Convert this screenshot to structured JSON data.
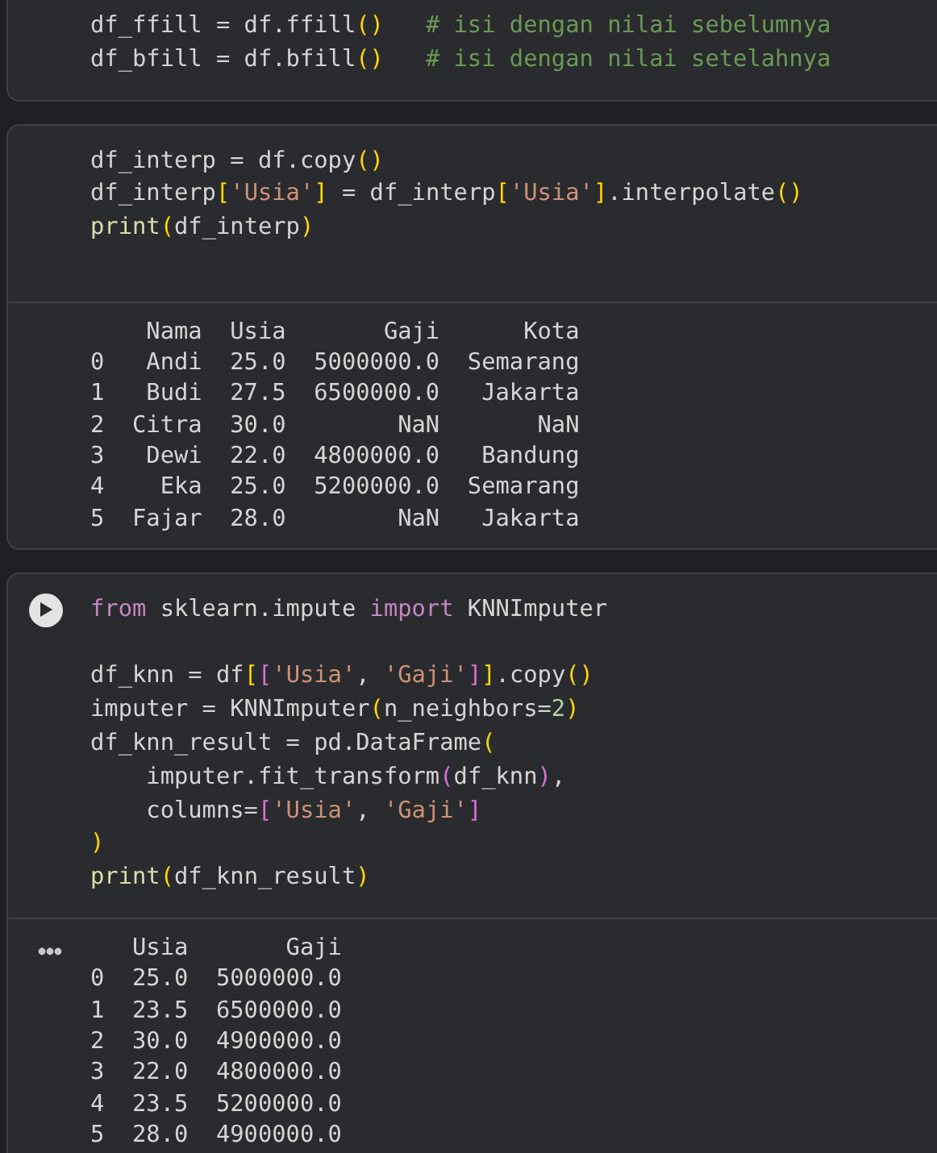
{
  "cells": [
    {
      "run_button": false,
      "code": [
        {
          "tokens": [
            {
              "text": "df_ffill = df.ffill",
              "kind": "plain"
            },
            {
              "text": "()",
              "kind": "paren"
            },
            {
              "text": "   # isi dengan nilai sebelumnya",
              "kind": "comment"
            }
          ]
        },
        {
          "tokens": [
            {
              "text": "df_bfill = df.bfill",
              "kind": "plain"
            },
            {
              "text": "()",
              "kind": "paren"
            },
            {
              "text": "   # isi dengan nilai setelahnya",
              "kind": "comment"
            }
          ]
        }
      ]
    },
    {
      "run_button": false,
      "code": [
        {
          "tokens": [
            {
              "text": "df_interp = df.copy",
              "kind": "plain"
            },
            {
              "text": "()",
              "kind": "paren"
            }
          ]
        },
        {
          "tokens": [
            {
              "text": "df_interp",
              "kind": "plain"
            },
            {
              "text": "[",
              "kind": "paren"
            },
            {
              "text": "'Usia'",
              "kind": "string"
            },
            {
              "text": "]",
              "kind": "paren"
            },
            {
              "text": " = df_interp",
              "kind": "plain"
            },
            {
              "text": "[",
              "kind": "paren"
            },
            {
              "text": "'Usia'",
              "kind": "string"
            },
            {
              "text": "]",
              "kind": "paren"
            },
            {
              "text": ".interpolate",
              "kind": "plain"
            },
            {
              "text": "()",
              "kind": "paren"
            }
          ]
        },
        {
          "tokens": [
            {
              "text": "print",
              "kind": "function"
            },
            {
              "text": "(",
              "kind": "paren"
            },
            {
              "text": "df_interp",
              "kind": "plain"
            },
            {
              "text": ")",
              "kind": "paren"
            }
          ],
          "gap_after": true
        }
      ],
      "output": {
        "menu": false,
        "lines": [
          "    Nama  Usia       Gaji      Kota",
          "0   Andi  25.0  5000000.0  Semarang",
          "1   Budi  27.5  6500000.0   Jakarta",
          "2  Citra  30.0        NaN       NaN",
          "3   Dewi  22.0  4800000.0   Bandung",
          "4    Eka  25.0  5200000.0  Semarang",
          "5  Fajar  28.0        NaN   Jakarta"
        ]
      }
    },
    {
      "run_button": true,
      "code": [
        {
          "tokens": [
            {
              "text": "from",
              "kind": "keyword"
            },
            {
              "text": " sklearn.impute ",
              "kind": "plain"
            },
            {
              "text": "import",
              "kind": "keyword"
            },
            {
              "text": " KNNImputer",
              "kind": "plain"
            }
          ]
        },
        {
          "tokens": [
            {
              "text": "df_knn = df",
              "kind": "plain"
            },
            {
              "text": "[",
              "kind": "paren"
            },
            {
              "text": "[",
              "kind": "paren2"
            },
            {
              "text": "'Usia'",
              "kind": "string"
            },
            {
              "text": ", ",
              "kind": "plain"
            },
            {
              "text": "'Gaji'",
              "kind": "string"
            },
            {
              "text": "]",
              "kind": "paren2"
            },
            {
              "text": "]",
              "kind": "paren"
            },
            {
              "text": ".copy",
              "kind": "plain"
            },
            {
              "text": "()",
              "kind": "paren"
            }
          ],
          "gap_before": true
        },
        {
          "tokens": [
            {
              "text": "imputer = KNNImputer",
              "kind": "plain"
            },
            {
              "text": "(",
              "kind": "paren"
            },
            {
              "text": "n_neighbors=",
              "kind": "plain"
            },
            {
              "text": "2",
              "kind": "number"
            },
            {
              "text": ")",
              "kind": "paren"
            }
          ]
        },
        {
          "tokens": [
            {
              "text": "df_knn_result = pd.DataFrame",
              "kind": "plain"
            },
            {
              "text": "(",
              "kind": "paren"
            }
          ]
        },
        {
          "tokens": [
            {
              "text": "    imputer.fit_transform",
              "kind": "plain"
            },
            {
              "text": "(",
              "kind": "paren2"
            },
            {
              "text": "df_knn",
              "kind": "plain"
            },
            {
              "text": ")",
              "kind": "paren2"
            },
            {
              "text": ",",
              "kind": "plain"
            }
          ]
        },
        {
          "tokens": [
            {
              "text": "    columns=",
              "kind": "plain"
            },
            {
              "text": "[",
              "kind": "paren2"
            },
            {
              "text": "'Usia'",
              "kind": "string"
            },
            {
              "text": ", ",
              "kind": "plain"
            },
            {
              "text": "'Gaji'",
              "kind": "string"
            },
            {
              "text": "]",
              "kind": "paren2"
            }
          ]
        },
        {
          "tokens": [
            {
              "text": ")",
              "kind": "paren"
            }
          ]
        },
        {
          "tokens": [
            {
              "text": "print",
              "kind": "function"
            },
            {
              "text": "(",
              "kind": "paren"
            },
            {
              "text": "df_knn_result",
              "kind": "plain"
            },
            {
              "text": ")",
              "kind": "paren"
            }
          ]
        }
      ],
      "output": {
        "menu": true,
        "lines": [
          "   Usia       Gaji",
          "0  25.0  5000000.0",
          "1  23.5  6500000.0",
          "2  30.0  4900000.0",
          "3  22.0  4800000.0",
          "4  23.5  5200000.0",
          "5  28.0  4900000.0"
        ]
      }
    }
  ]
}
